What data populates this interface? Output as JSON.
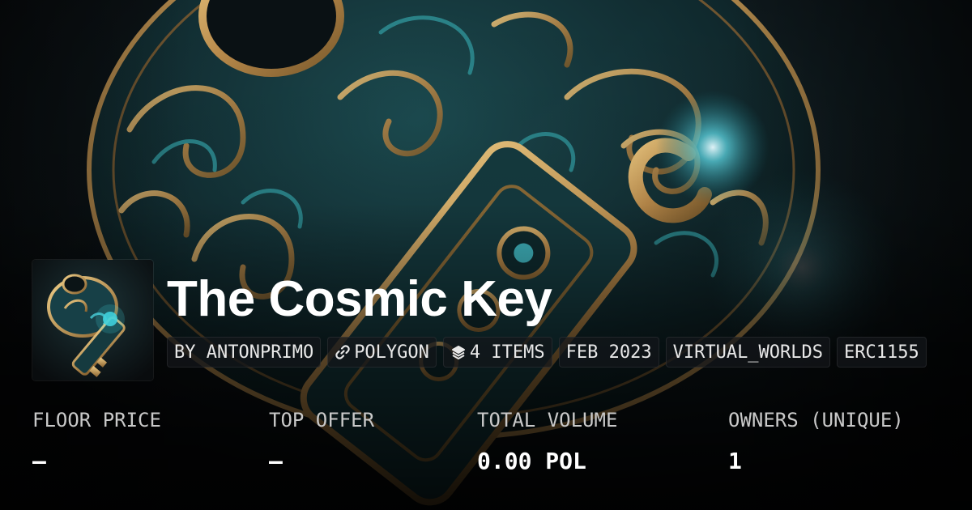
{
  "collection": {
    "title": "The Cosmic Key",
    "badges": [
      {
        "icon": "none",
        "text": "BY ANTONPRIMO"
      },
      {
        "icon": "chain-link-icon",
        "text": "POLYGON"
      },
      {
        "icon": "layers-icon",
        "text": "4 ITEMS"
      },
      {
        "icon": "none",
        "text": "FEB 2023"
      },
      {
        "icon": "none",
        "text": "VIRTUAL_WORLDS"
      },
      {
        "icon": "none",
        "text": "ERC1155"
      }
    ]
  },
  "stats": [
    {
      "label": "FLOOR PRICE",
      "value": "—"
    },
    {
      "label": "TOP OFFER",
      "value": "—"
    },
    {
      "label": "TOTAL VOLUME",
      "value": "0.00 POL"
    },
    {
      "label": "OWNERS (UNIQUE)",
      "value": "1"
    }
  ],
  "colors": {
    "background": "#0a0b0d",
    "teal_accent": "#2a8a90",
    "gold_accent": "#c9a25a"
  }
}
